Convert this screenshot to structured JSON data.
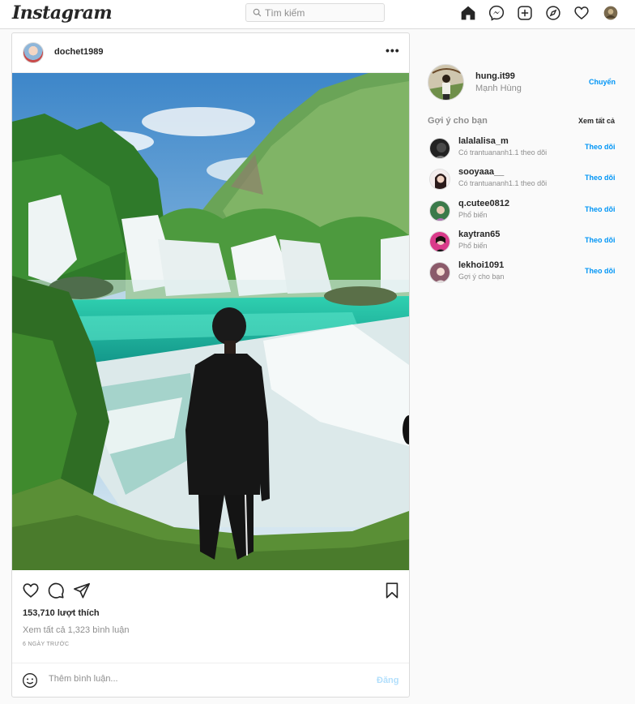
{
  "nav": {
    "logo": "Instagram",
    "search_placeholder": "Tìm kiếm",
    "icons": [
      "home-icon",
      "messenger-icon",
      "new-post-icon",
      "explore-icon",
      "activity-heart-icon",
      "profile-avatar"
    ]
  },
  "post": {
    "username": "dochet1989",
    "more_label": "•••",
    "likes": "153,710 lượt thích",
    "view_comments": "Xem tất cả 1,323 bình luận",
    "time_ago": "6 NGÀY TRƯỚC",
    "comment_placeholder": "Thêm bình luận...",
    "post_button": "Đăng"
  },
  "sidebar": {
    "me": {
      "username": "hung.it99",
      "name": "Mạnh Hùng",
      "switch_label": "Chuyển"
    },
    "suggestions_title": "Gợi ý cho bạn",
    "see_all": "Xem tất cả",
    "suggestions": [
      {
        "username": "lalalalisa_m",
        "sub": "Có trantuananh1.1 theo dõi",
        "follow": "Theo dõi"
      },
      {
        "username": "sooyaaa__",
        "sub": "Có trantuananh1.1 theo dõi",
        "follow": "Theo dõi"
      },
      {
        "username": "q.cutee0812",
        "sub": "Phổ biến",
        "follow": "Theo dõi"
      },
      {
        "username": "kaytran65",
        "sub": "Phổ biến",
        "follow": "Theo dõi"
      },
      {
        "username": "lekhoi1091",
        "sub": "Gợi ý cho bạn",
        "follow": "Theo dõi"
      }
    ]
  },
  "colors": {
    "link_blue": "#0095f6",
    "muted": "#8e8e8e",
    "border": "#dbdbdb",
    "post_disabled": "#b2dffc"
  }
}
